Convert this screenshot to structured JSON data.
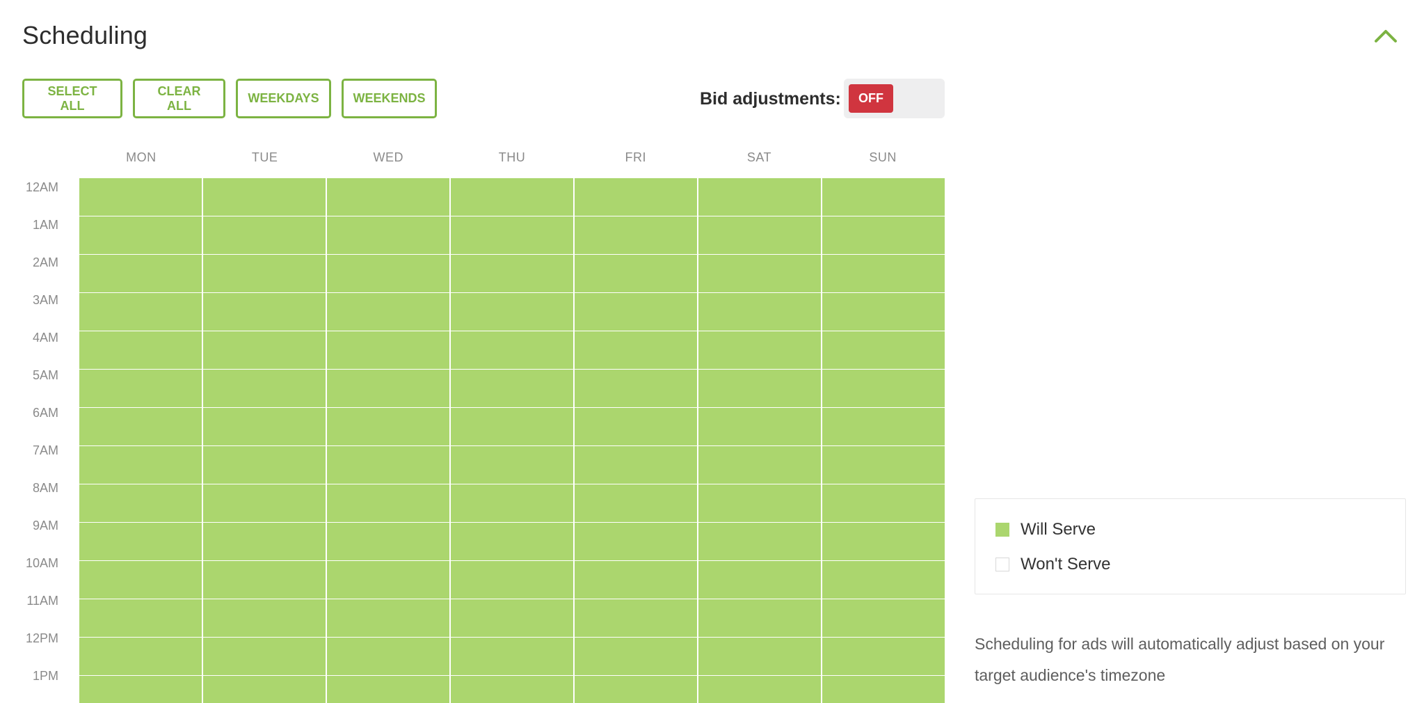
{
  "header": {
    "title": "Scheduling",
    "collapse_icon": "chevron-up-icon",
    "accent_color": "#7cb342"
  },
  "toolbar": {
    "select_all": "SELECT ALL",
    "clear_all": "CLEAR ALL",
    "weekdays": "WEEKDAYS",
    "weekends": "WEEKENDS"
  },
  "bid_adjustments": {
    "label": "Bid adjustments:",
    "state": "OFF",
    "state_color": "#d0353f"
  },
  "schedule": {
    "days": [
      "MON",
      "TUE",
      "WED",
      "THU",
      "FRI",
      "SAT",
      "SUN"
    ],
    "hours": [
      "12AM",
      "1AM",
      "2AM",
      "3AM",
      "4AM",
      "5AM",
      "6AM",
      "7AM",
      "8AM",
      "9AM",
      "10AM",
      "11AM",
      "12PM",
      "1PM"
    ],
    "serving_color": "#abd66e",
    "all_serving": true
  },
  "legend": {
    "will_serve": "Will Serve",
    "wont_serve": "Won't Serve"
  },
  "note": "Scheduling for ads will automatically adjust based on your target audience's timezone"
}
